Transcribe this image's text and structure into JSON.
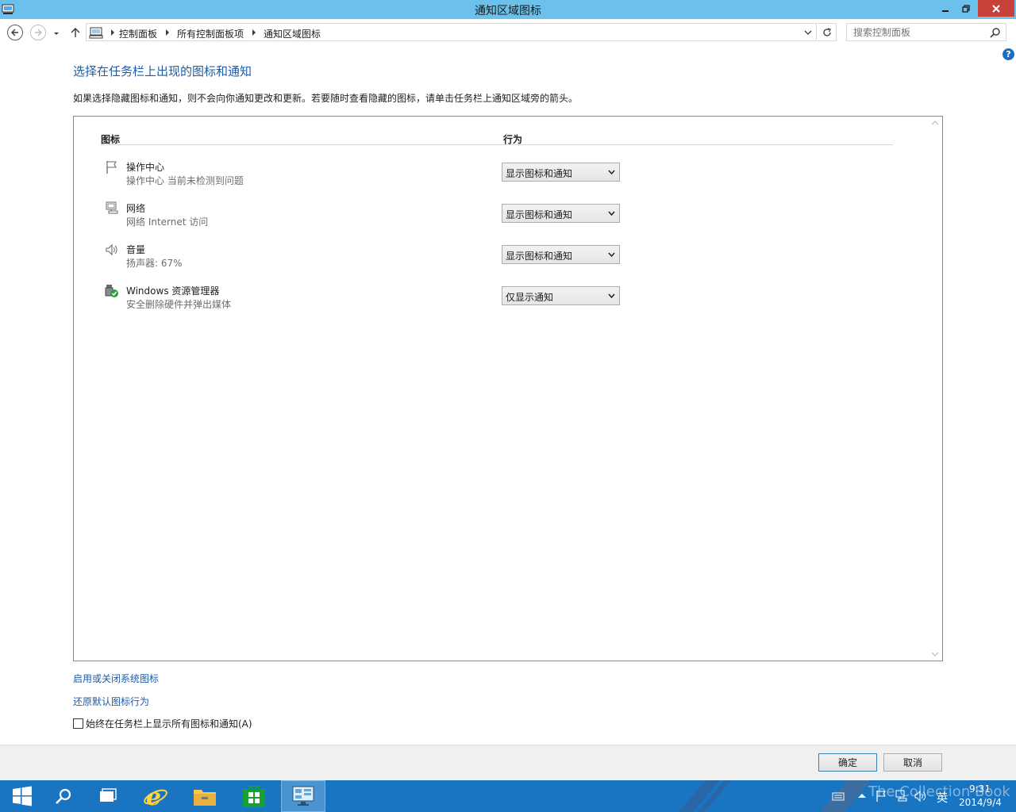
{
  "window": {
    "title": "通知区域图标",
    "minimize_label": "—",
    "maximize_label": "❐",
    "close_label": "✕"
  },
  "nav": {
    "breadcrumbs": [
      "控制面板",
      "所有控制面板项",
      "通知区域图标"
    ],
    "search_placeholder": "搜索控制面板"
  },
  "help_label": "?",
  "page": {
    "heading": "选择在任务栏上出现的图标和通知",
    "description": "如果选择隐藏图标和通知，则不会向你通知更改和更新。若要随时查看隐藏的图标，请单击任务栏上通知区域旁的箭头。"
  },
  "list": {
    "col_icon": "图标",
    "col_behavior": "行为",
    "rows": [
      {
        "icon": "flag-icon",
        "name": "操作中心",
        "subtitle": "操作中心  当前未检测到问题",
        "behavior": "显示图标和通知"
      },
      {
        "icon": "network-icon",
        "name": "网络",
        "subtitle": "网络 Internet 访问",
        "behavior": "显示图标和通知"
      },
      {
        "icon": "speaker-icon",
        "name": "音量",
        "subtitle": "扬声器: 67%",
        "behavior": "显示图标和通知"
      },
      {
        "icon": "safely-remove-icon",
        "name": "Windows 资源管理器",
        "subtitle": "安全删除硬件并弹出媒体",
        "behavior": "仅显示通知"
      }
    ]
  },
  "links": {
    "system_icons": "启用或关闭系统图标",
    "restore_defaults": "还原默认图标行为"
  },
  "checkbox": {
    "label": "始终在任务栏上显示所有图标和通知(A)",
    "checked": false
  },
  "buttons": {
    "ok": "确定",
    "cancel": "取消"
  },
  "taskbar": {
    "items": [
      "start-icon",
      "search-icon",
      "task-view-icon",
      "internet-explorer-icon",
      "file-explorer-icon",
      "store-icon",
      "control-panel-icon"
    ],
    "active_item": "control-panel-icon",
    "clock_time": "9:31",
    "clock_date": "2014/9/4",
    "ime_label": "英",
    "watermark": "The Collection Book"
  },
  "colors": {
    "titlebar": "#6bc0ec",
    "close_button": "#c7403a",
    "heading": "#1e5ba8",
    "taskbar": "#1975c2"
  }
}
